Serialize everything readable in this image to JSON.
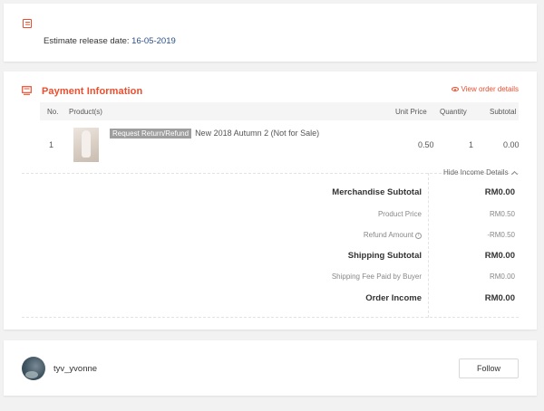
{
  "release": {
    "label": "Estimate release date: ",
    "date": "16-05-2019"
  },
  "payment": {
    "title": "Payment Information",
    "view_details": "View order details",
    "columns": {
      "no": "No.",
      "products": "Product(s)",
      "unit_price": "Unit Price",
      "quantity": "Quantity",
      "subtotal": "Subtotal"
    },
    "items": [
      {
        "no": "1",
        "badge": "Request Return/Refund",
        "name": "New 2018 Autumn 2 (Not for Sale)",
        "unit_price": "0.50",
        "quantity": "1",
        "subtotal": "0.00"
      }
    ],
    "hide_income": "Hide Income Details",
    "income": {
      "merchandise_subtotal_label": "Merchandise Subtotal",
      "merchandise_subtotal_value": "RM0.00",
      "product_price_label": "Product Price",
      "product_price_value": "RM0.50",
      "refund_amount_label": "Refund Amount",
      "refund_amount_value": "-RM0.50",
      "shipping_subtotal_label": "Shipping Subtotal",
      "shipping_subtotal_value": "RM0.00",
      "shipping_fee_label": "Shipping Fee Paid by Buyer",
      "shipping_fee_value": "RM0.00",
      "order_income_label": "Order Income",
      "order_income_value": "RM0.00"
    }
  },
  "buyer": {
    "username": "tyv_yvonne",
    "follow_label": "Follow"
  },
  "colors": {
    "accent": "#ee4d2d",
    "link_blue": "#2a4f8a"
  },
  "icons": {
    "release": "document-icon",
    "payment": "payment-icon",
    "view_details": "eye-icon",
    "collapse": "chevron-up-icon",
    "refund_info": "info-icon"
  }
}
